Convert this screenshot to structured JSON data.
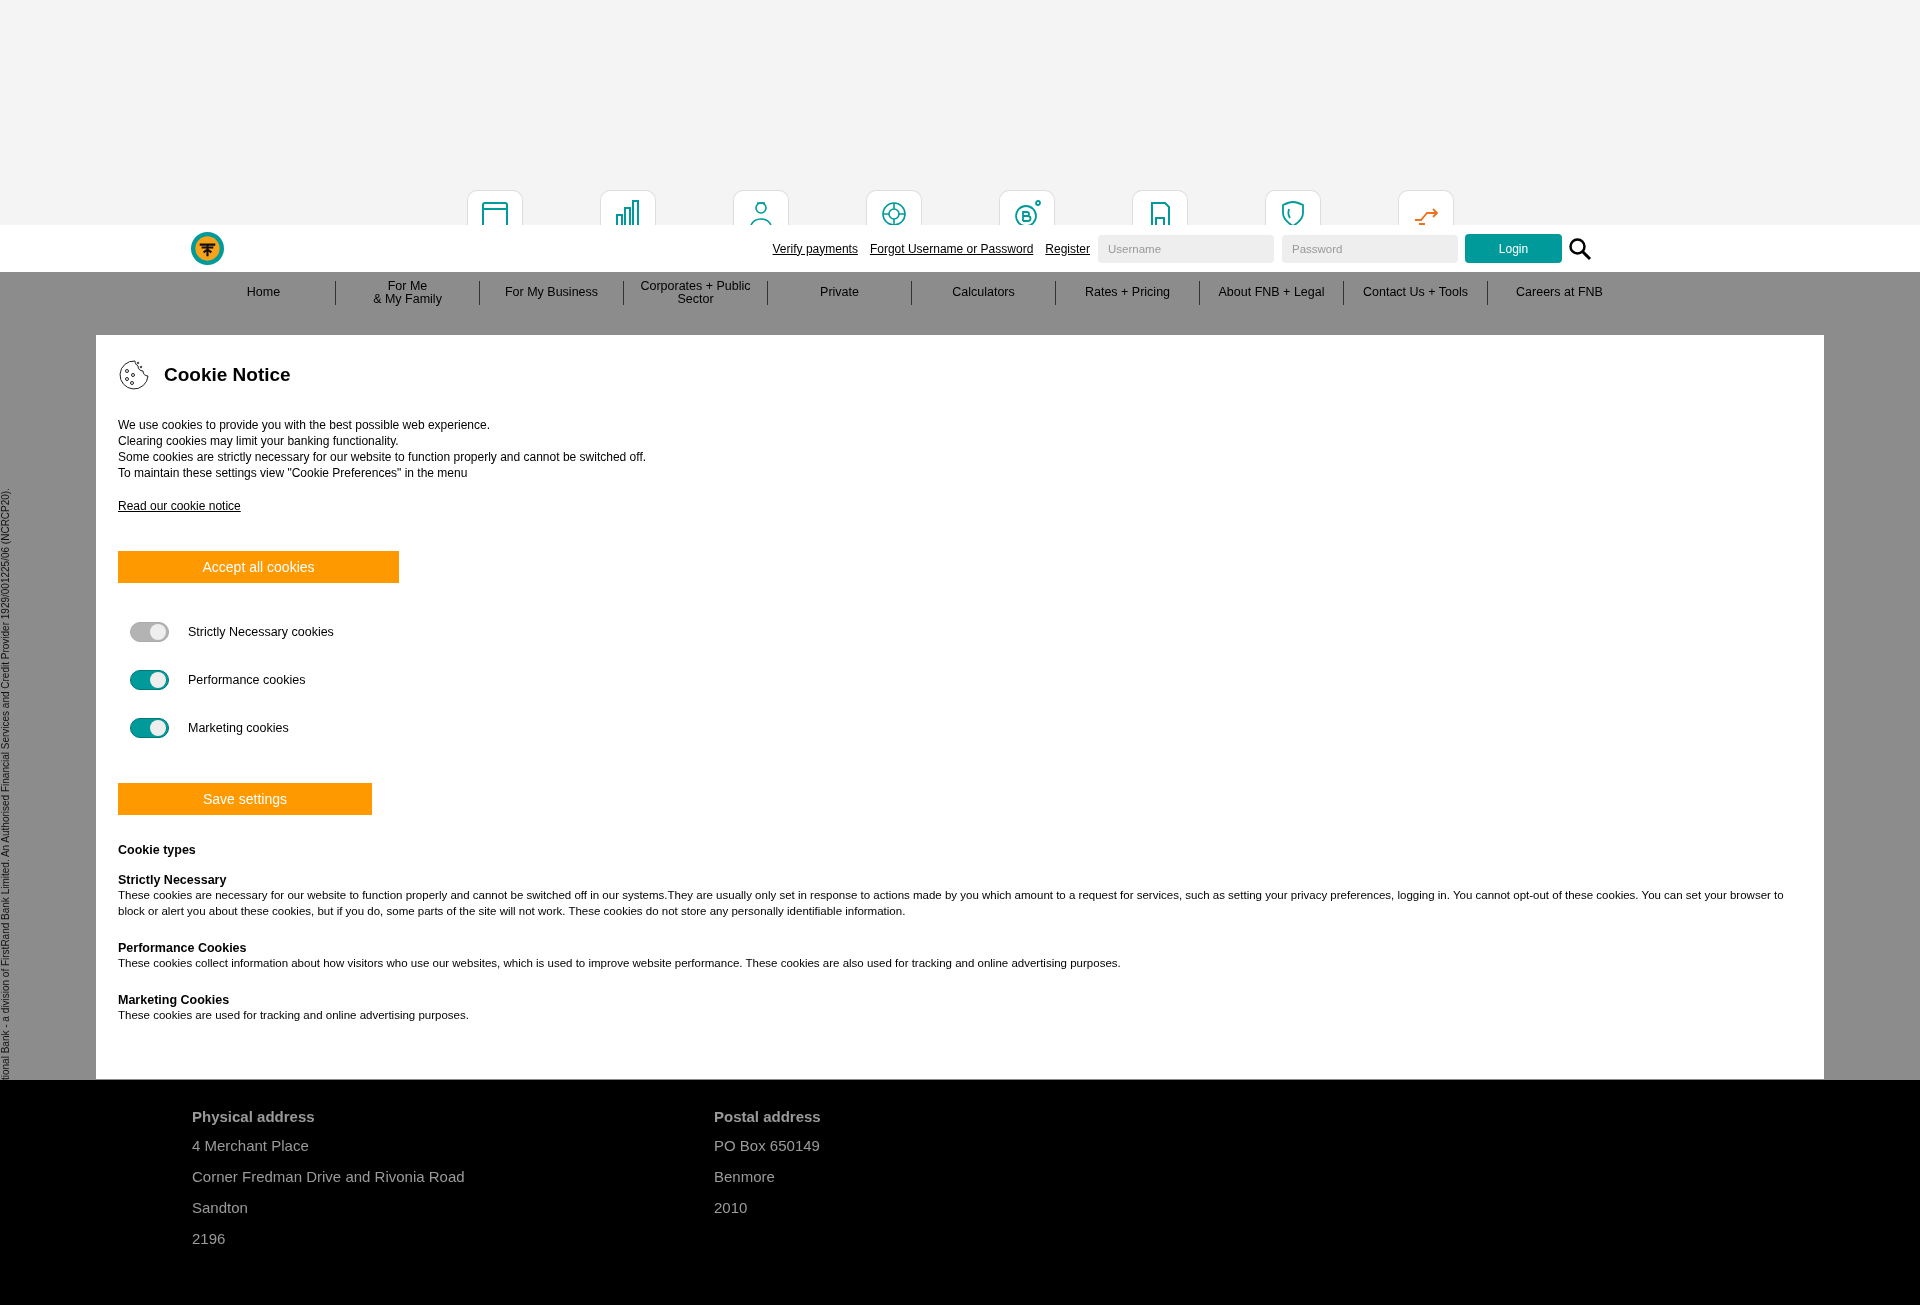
{
  "quick_links": [
    {
      "kind": "card"
    },
    {
      "kind": "chart"
    },
    {
      "kind": "person"
    },
    {
      "kind": "lifebuoy"
    },
    {
      "kind": "coin"
    },
    {
      "kind": "sim"
    },
    {
      "kind": "shield"
    },
    {
      "kind": "transfer"
    }
  ],
  "header": {
    "links": [
      "Verify payments",
      "Forgot Username or Password",
      "Register"
    ],
    "username": {
      "placeholder": "Username"
    },
    "password": {
      "placeholder": "Password"
    },
    "login": "Login"
  },
  "nav": [
    "Home",
    "For Me\n& My Family",
    "For My Business",
    "Corporates + Public\nSector",
    "Private",
    "Calculators",
    "Rates + Pricing",
    "About FNB + Legal",
    "Contact Us + Tools",
    "Careers at FNB"
  ],
  "side_text": "tional Bank - a division of FirstRand Bank Limited. An Authorised Financial Services and Credit Provider 1929/001225/06 (NCRCP20).",
  "cookie_notice": {
    "title": "Cookie Notice",
    "intro": [
      "We use cookies to provide you with the best possible web experience.",
      "Clearing cookies may limit your banking functionality.",
      "Some cookies are strictly necessary for our website to function properly and cannot be switched off.",
      "To maintain these settings view \"Cookie Preferences\" in the menu"
    ],
    "link": "Read our cookie notice",
    "accept": "Accept all cookies",
    "toggles": [
      {
        "label": "Strictly Necessary cookies",
        "on": true,
        "disabled": true
      },
      {
        "label": "Performance cookies",
        "on": true,
        "disabled": false
      },
      {
        "label": "Marketing cookies",
        "on": true,
        "disabled": false
      }
    ],
    "save": "Save settings",
    "types_heading": "Cookie types",
    "types": [
      {
        "title": "Strictly Necessary",
        "text": "These cookies are necessary for our website to function properly and cannot be switched off in our systems.They are usually only set in response to actions made by you which amount to a request for services, such as setting your privacy preferences, logging in. You cannot opt-out of these cookies. You can set your browser to block or alert you about these cookies, but if you do, some parts of the site will not work. These cookies do not store any personally identifiable information."
      },
      {
        "title": "Performance Cookies",
        "text": "These cookies collect information about how visitors who use our websites, which is used to improve website performance. These cookies are also used for tracking and online advertising purposes."
      },
      {
        "title": "Marketing Cookies",
        "text": "These cookies are used for tracking and online advertising purposes."
      }
    ]
  },
  "footer": [
    {
      "heading": "Physical address",
      "lines": [
        "4 Merchant Place",
        "Corner Fredman Drive and Rivonia Road",
        "Sandton",
        "2196"
      ]
    },
    {
      "heading": "Postal address",
      "lines": [
        "PO Box 650149",
        "Benmore",
        "2010"
      ]
    }
  ]
}
